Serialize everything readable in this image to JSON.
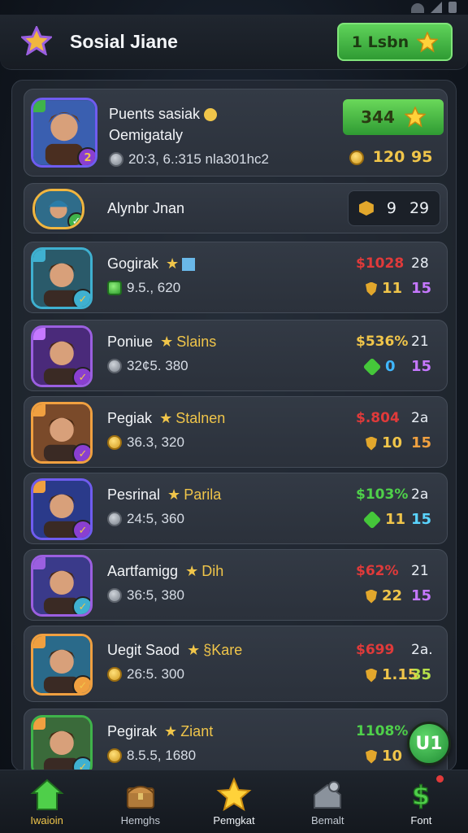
{
  "app": {
    "title": "Sosial Jiane"
  },
  "header": {
    "button_label": "1 Lsbn",
    "button_icon": "star-icon"
  },
  "top_entry": {
    "name": "Puents sasiak",
    "subtitle": "Oemigataly",
    "level": "2",
    "stats": "20:3, 6.:315 nla301hc2",
    "button_value": "344",
    "coins": "120",
    "score": "95"
  },
  "pinned_entry": {
    "name": "Alynbr Jnan",
    "value_a": "9",
    "value_b": "29"
  },
  "entries": [
    {
      "name": "Gogirak",
      "name_accent": "",
      "stats": "9.5., 620",
      "pct": "$1028",
      "pct_color": "#e03a3a",
      "rank": "28",
      "stat_a": "11",
      "stat_b": "15",
      "stat_a_color": "#f0c54a",
      "stat_b_color": "#c678ff"
    },
    {
      "name": "Poniue",
      "name_accent": "Slains",
      "stats": "32¢5. 380",
      "pct": "$536%",
      "pct_color": "#f0c54a",
      "rank": "21",
      "stat_a": "0",
      "stat_b": "15",
      "stat_a_color": "#3fb7ff",
      "stat_b_color": "#c678ff"
    },
    {
      "name": "Pegiak",
      "name_accent": "Stalnen",
      "stats": "36.3, 320",
      "pct": "$.804",
      "pct_color": "#e03a3a",
      "rank": "2a",
      "stat_a": "10",
      "stat_b": "15",
      "stat_a_color": "#f0c54a",
      "stat_b_color": "#f0a040"
    },
    {
      "name": "Pesrinal",
      "name_accent": "Parila",
      "stats": "24:5, 360",
      "pct": "$103%",
      "pct_color": "#4fd04a",
      "rank": "2a",
      "stat_a": "11",
      "stat_b": "15",
      "stat_a_color": "#f0c54a",
      "stat_b_color": "#5ad4ff"
    },
    {
      "name": "Aartfamigg",
      "name_accent": "Dih",
      "stats": "36:5, 380",
      "pct": "$62%",
      "pct_color": "#e03a3a",
      "rank": "21",
      "stat_a": "22",
      "stat_b": "15",
      "stat_a_color": "#f0c54a",
      "stat_b_color": "#c678ff"
    },
    {
      "name": "Uegit Saod",
      "name_accent": "§Kare",
      "stats": "26:5. 300",
      "pct": "$699",
      "pct_color": "#e03a3a",
      "rank": "2a.",
      "stat_a": "1.15",
      "stat_b": "35",
      "stat_a_color": "#f0c54a",
      "stat_b_color": "#b7e04a"
    },
    {
      "name": "Pegirak",
      "name_accent": "Ziant",
      "stats": "8.5.5, 1680",
      "pct": "1108%",
      "pct_color": "#4fd04a",
      "rank": "",
      "stat_a": "10",
      "stat_b": "",
      "stat_a_color": "#f0c54a",
      "stat_b_color": "#c678ff"
    }
  ],
  "fab": {
    "label": "U1"
  },
  "nav": [
    {
      "label": "Iwaioin",
      "icon": "home-icon"
    },
    {
      "label": "Hemghs",
      "icon": "chest-icon"
    },
    {
      "label": "Pemgkat",
      "icon": "star-icon"
    },
    {
      "label": "Bemalt",
      "icon": "gamepad-icon"
    },
    {
      "label": "Font",
      "icon": "dollar-icon"
    }
  ]
}
